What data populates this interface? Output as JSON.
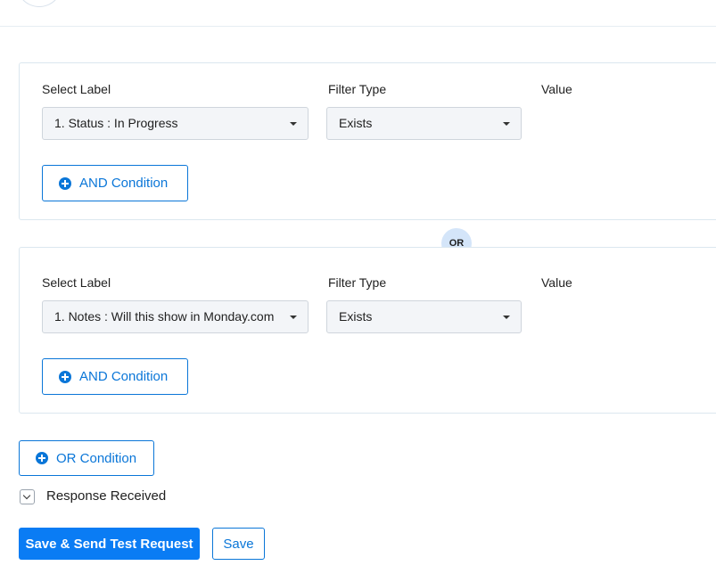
{
  "condition_groups": [
    {
      "labels": {
        "select_label": "Select Label",
        "filter_type": "Filter Type",
        "value": "Value"
      },
      "select_label_value": "1. Status : In Progress",
      "filter_type_value": "Exists",
      "and_button_label": "AND Condition"
    },
    {
      "labels": {
        "select_label": "Select Label",
        "filter_type": "Filter Type",
        "value": "Value"
      },
      "select_label_value": "1. Notes : Will this show in Monday.com",
      "filter_type_value": "Exists",
      "and_button_label": "AND Condition"
    }
  ],
  "or_separator": "OR",
  "or_button_label": "OR Condition",
  "response_section": {
    "label": "Response Received",
    "icon": "chevron-down-icon"
  },
  "actions": {
    "save_and_send_label": "Save & Send Test Request",
    "save_label": "Save"
  },
  "colors": {
    "accent": "#0a76d8",
    "primary_button": "#0a7cf4",
    "or_badge": "#d4e5f9",
    "select_background": "#f3f5f8"
  }
}
